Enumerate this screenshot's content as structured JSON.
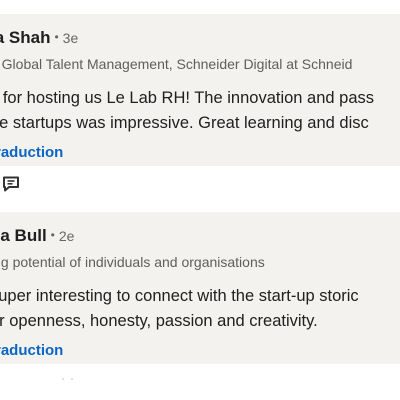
{
  "comments": [
    {
      "author": "la Shah",
      "time": "3e",
      "headline": "r, Global Talent Management, Schneider Digital at Schneid",
      "text_lines": [
        "s for hosting us Le Lab RH! The innovation and pass",
        "he startups was impressive. Great learning and disc"
      ],
      "translate_label": "traduction"
    },
    {
      "author": "pa Bull",
      "time": "2e",
      "headline": "ing potential of individuals and organisations",
      "text_lines": [
        "super interesting to connect with the start-up storic",
        "ur openness, honesty, passion and creativity."
      ],
      "translate_label": "traduction"
    }
  ],
  "icons": {
    "reply": "comment-icon"
  },
  "colors": {
    "card_bg": "#f3f2ef",
    "link": "#0a66c2",
    "secondary_text": "#5e5e5e"
  }
}
